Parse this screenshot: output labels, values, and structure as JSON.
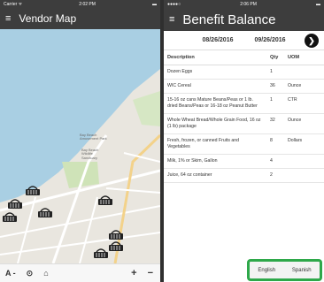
{
  "left": {
    "status": {
      "carrier": "Carrier ᯤ",
      "time": "2:02 PM",
      "battery": "▬"
    },
    "title": "Vendor Map",
    "map": {
      "label_amusement": "Bay Beach Amusement Park",
      "label_wildlife": "Bay Beach Wildlife Sanctuary"
    },
    "bottom": {
      "font": "A -",
      "locate": "⊙",
      "basket": "⌂",
      "zoom_in": "+",
      "zoom_out": "−"
    }
  },
  "right": {
    "status": {
      "carrier": "●●●●○",
      "time": "2:06 PM",
      "battery": "▬"
    },
    "title": "Benefit Balance",
    "date_from": "08/26/2016",
    "date_to": "09/26/2016",
    "columns": [
      "Description",
      "Qty",
      "UOM"
    ],
    "rows": [
      [
        "Dozen Eggs",
        "1",
        ""
      ],
      [
        "WIC Cereal",
        "36",
        "Ounce"
      ],
      [
        "15-16 oz cans Mature Beans/Peas or 1 lb. dried Beans/Peas or 16-18 oz Peanut Butter",
        "1",
        "CTR"
      ],
      [
        "Whole Wheat Bread/Whole Grain Food, 16 oz (1 lb) package",
        "32",
        "Ounce"
      ],
      [
        "Fresh, frozen, or canned Fruits and Vegetables",
        "8",
        "Dollars"
      ],
      [
        "Milk, 1% or Skim, Gallon",
        "4",
        ""
      ],
      [
        "Juice, 64 oz container",
        "2",
        ""
      ]
    ],
    "lang": {
      "english": "English",
      "spanish": "Spanish"
    }
  }
}
